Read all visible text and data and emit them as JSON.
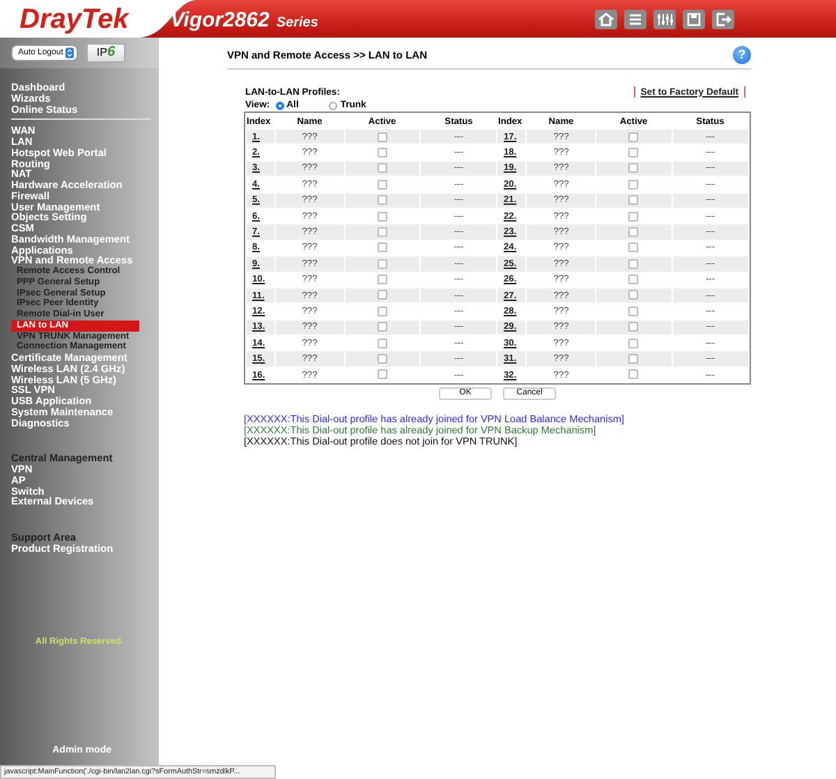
{
  "header": {
    "logo": "DrayTek",
    "model": "Vigor2862",
    "series": "Series"
  },
  "sidebar": {
    "auto_logout": "Auto Logout",
    "ipv6": {
      "prefix": "IP",
      "suffix": "6"
    },
    "groups": [
      {
        "items": [
          {
            "label": "Dashboard",
            "kind": "main",
            "selected": false
          },
          {
            "label": "Wizards",
            "kind": "main",
            "selected": false
          },
          {
            "label": "Online Status",
            "kind": "main",
            "selected": false
          }
        ]
      },
      {
        "items": [
          {
            "label": "WAN",
            "kind": "main",
            "selected": false
          },
          {
            "label": "LAN",
            "kind": "main",
            "selected": false
          },
          {
            "label": "Hotspot Web Portal",
            "kind": "main",
            "selected": false
          },
          {
            "label": "Routing",
            "kind": "main",
            "selected": false
          },
          {
            "label": "NAT",
            "kind": "main",
            "selected": false
          },
          {
            "label": "Hardware Acceleration",
            "kind": "main",
            "selected": false
          },
          {
            "label": "Firewall",
            "kind": "main",
            "selected": false
          },
          {
            "label": "User Management",
            "kind": "main",
            "selected": false
          },
          {
            "label": "Objects Setting",
            "kind": "main",
            "selected": false
          },
          {
            "label": "CSM",
            "kind": "main",
            "selected": false
          },
          {
            "label": "Bandwidth Management",
            "kind": "main",
            "selected": false
          },
          {
            "label": "Applications",
            "kind": "main",
            "selected": false
          },
          {
            "label": "VPN and Remote Access",
            "kind": "main",
            "selected": false
          },
          {
            "label": "Remote Access Control",
            "kind": "sub",
            "selected": false
          },
          {
            "label": "PPP General Setup",
            "kind": "sub",
            "selected": false
          },
          {
            "label": "IPsec General Setup",
            "kind": "sub",
            "selected": false
          },
          {
            "label": "IPsec Peer Identity",
            "kind": "sub",
            "selected": false
          },
          {
            "label": "Remote Dial-in User",
            "kind": "sub",
            "selected": false
          },
          {
            "label": "LAN to LAN",
            "kind": "sub",
            "selected": true
          },
          {
            "label": "VPN TRUNK Management",
            "kind": "sub",
            "selected": false
          },
          {
            "label": "Connection Management",
            "kind": "sub",
            "selected": false
          },
          {
            "label": "Certificate Management",
            "kind": "main",
            "selected": false
          },
          {
            "label": "Wireless LAN (2.4 GHz)",
            "kind": "main",
            "selected": false
          },
          {
            "label": "Wireless LAN (5 GHz)",
            "kind": "main",
            "selected": false
          },
          {
            "label": "SSL VPN",
            "kind": "main",
            "selected": false
          },
          {
            "label": "USB Application",
            "kind": "main",
            "selected": false
          },
          {
            "label": "System Maintenance",
            "kind": "main",
            "selected": false
          },
          {
            "label": "Diagnostics",
            "kind": "main",
            "selected": false
          }
        ]
      },
      {
        "items": [
          {
            "label": "Central Management",
            "kind": "heading",
            "selected": false
          },
          {
            "label": "VPN",
            "kind": "main",
            "selected": false
          },
          {
            "label": "AP",
            "kind": "main",
            "selected": false
          },
          {
            "label": "Switch",
            "kind": "main",
            "selected": false
          },
          {
            "label": "External Devices",
            "kind": "main",
            "selected": false
          }
        ]
      },
      {
        "items": [
          {
            "label": "Support Area",
            "kind": "heading",
            "selected": false
          },
          {
            "label": "Product Registration",
            "kind": "main",
            "selected": false
          }
        ]
      }
    ],
    "rights": "All Rights Reserved.",
    "mode": "Admin mode"
  },
  "breadcrumb": "VPN and Remote Access >> LAN to LAN",
  "help": "?",
  "profiles_label": "LAN-to-LAN Profiles:",
  "factory_default": "Set to Factory Default",
  "view": {
    "label": "View:",
    "options": [
      {
        "label": "All",
        "selected": true
      },
      {
        "label": "Trunk",
        "selected": false
      }
    ]
  },
  "table": {
    "columns": [
      "Index",
      "Name",
      "Active",
      "Status",
      "Index",
      "Name",
      "Active",
      "Status"
    ],
    "profiles": [
      {
        "index": "1.",
        "name": "???",
        "active": false,
        "status": "---"
      },
      {
        "index": "2.",
        "name": "???",
        "active": false,
        "status": "---"
      },
      {
        "index": "3.",
        "name": "???",
        "active": false,
        "status": "---"
      },
      {
        "index": "4.",
        "name": "???",
        "active": false,
        "status": "---"
      },
      {
        "index": "5.",
        "name": "???",
        "active": false,
        "status": "---"
      },
      {
        "index": "6.",
        "name": "???",
        "active": false,
        "status": "---"
      },
      {
        "index": "7.",
        "name": "???",
        "active": false,
        "status": "---"
      },
      {
        "index": "8.",
        "name": "???",
        "active": false,
        "status": "---"
      },
      {
        "index": "9.",
        "name": "???",
        "active": false,
        "status": "---"
      },
      {
        "index": "10.",
        "name": "???",
        "active": false,
        "status": "---"
      },
      {
        "index": "11.",
        "name": "???",
        "active": false,
        "status": "---"
      },
      {
        "index": "12.",
        "name": "???",
        "active": false,
        "status": "---"
      },
      {
        "index": "13.",
        "name": "???",
        "active": false,
        "status": "---"
      },
      {
        "index": "14.",
        "name": "???",
        "active": false,
        "status": "---"
      },
      {
        "index": "15.",
        "name": "???",
        "active": false,
        "status": "---"
      },
      {
        "index": "16.",
        "name": "???",
        "active": false,
        "status": "---"
      },
      {
        "index": "17.",
        "name": "???",
        "active": false,
        "status": "---"
      },
      {
        "index": "18.",
        "name": "???",
        "active": false,
        "status": "---"
      },
      {
        "index": "19.",
        "name": "???",
        "active": false,
        "status": "---"
      },
      {
        "index": "20.",
        "name": "???",
        "active": false,
        "status": "---"
      },
      {
        "index": "21.",
        "name": "???",
        "active": false,
        "status": "---"
      },
      {
        "index": "22.",
        "name": "???",
        "active": false,
        "status": "---"
      },
      {
        "index": "23.",
        "name": "???",
        "active": false,
        "status": "---"
      },
      {
        "index": "24.",
        "name": "???",
        "active": false,
        "status": "---"
      },
      {
        "index": "25.",
        "name": "???",
        "active": false,
        "status": "---"
      },
      {
        "index": "26.",
        "name": "???",
        "active": false,
        "status": "---"
      },
      {
        "index": "27.",
        "name": "???",
        "active": false,
        "status": "---"
      },
      {
        "index": "28.",
        "name": "???",
        "active": false,
        "status": "---"
      },
      {
        "index": "29.",
        "name": "???",
        "active": false,
        "status": "---"
      },
      {
        "index": "30.",
        "name": "???",
        "active": false,
        "status": "---"
      },
      {
        "index": "31.",
        "name": "???",
        "active": false,
        "status": "---"
      },
      {
        "index": "32.",
        "name": "???",
        "active": false,
        "status": "---"
      }
    ]
  },
  "buttons": [
    "OK",
    "Cancel"
  ],
  "notes": [
    {
      "text": "[XXXXXX:This Dial-out profile has already joined for VPN Load Balance Mechanism]",
      "color": "#2b2bff"
    },
    {
      "text": "[XXXXXX:This Dial-out profile has already joined for VPN Backup Mechanism]",
      "color": "#2e7d32"
    },
    {
      "text": "[XXXXXX:This Dial-out profile does not join for VPN TRUNK]",
      "color": "#111111"
    }
  ],
  "status_bar": "javascript:MainFunction('./cgi-bin/lan2lan.cgi?sFormAuthStr=smzdlkP..."
}
